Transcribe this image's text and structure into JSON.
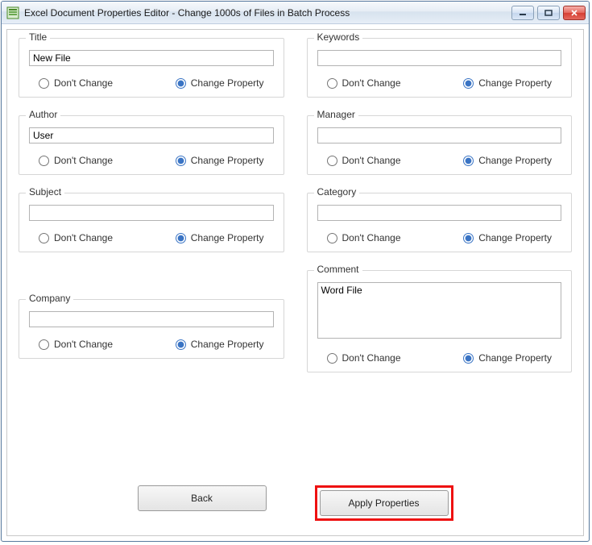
{
  "window": {
    "title": "Excel Document Properties Editor - Change 1000s of Files in Batch Process"
  },
  "radio_labels": {
    "dont_change": "Don't Change",
    "change_property": "Change Property"
  },
  "buttons": {
    "back": "Back",
    "apply": "Apply Properties"
  },
  "groups": {
    "title": {
      "label": "Title",
      "value": "New File",
      "selected": "change"
    },
    "author": {
      "label": "Author",
      "value": "User",
      "selected": "change"
    },
    "subject": {
      "label": "Subject",
      "value": "",
      "selected": "change"
    },
    "company": {
      "label": "Company",
      "value": "",
      "selected": "change"
    },
    "keywords": {
      "label": "Keywords",
      "value": "",
      "selected": "change"
    },
    "manager": {
      "label": "Manager",
      "value": "",
      "selected": "change"
    },
    "category": {
      "label": "Category",
      "value": "",
      "selected": "change"
    },
    "comment": {
      "label": "Comment",
      "value": "Word File",
      "selected": "change"
    }
  }
}
